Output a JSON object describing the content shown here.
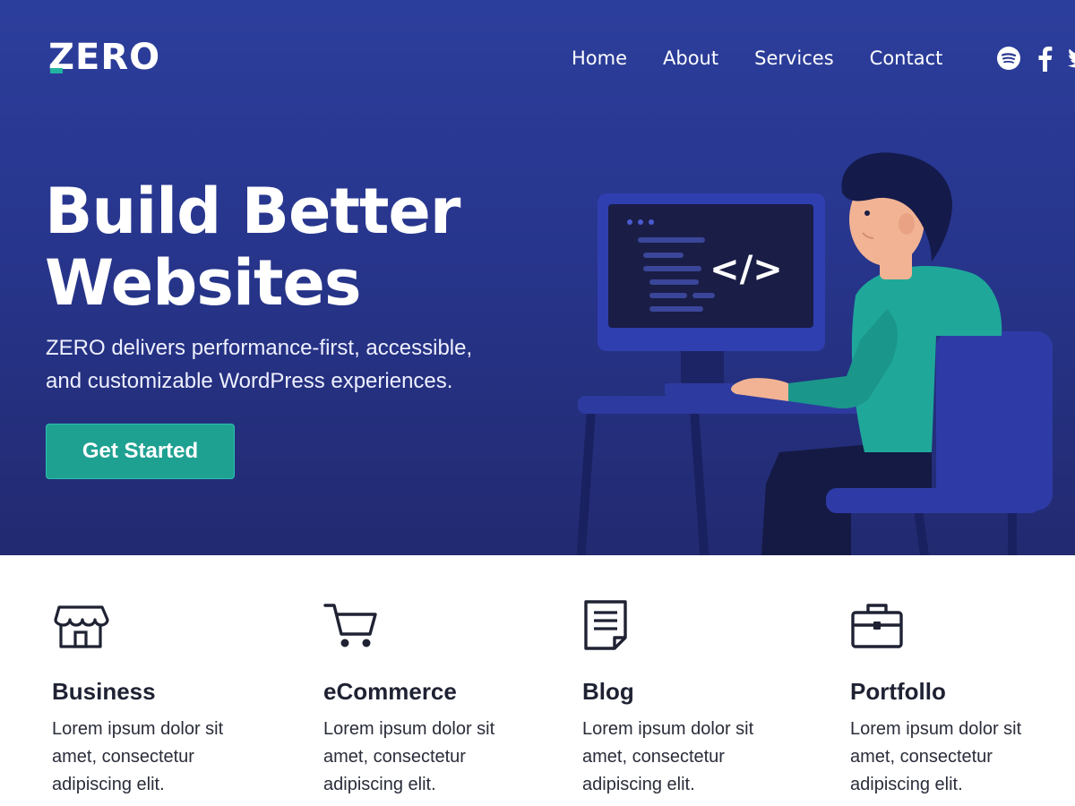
{
  "header": {
    "logo": "ZERO",
    "nav": [
      {
        "label": "Home"
      },
      {
        "label": "About"
      },
      {
        "label": "Services"
      },
      {
        "label": "Contact"
      }
    ],
    "social": [
      "spotify-icon",
      "facebook-icon",
      "twitter-icon"
    ]
  },
  "hero": {
    "headline_line1": "Build Better",
    "headline_line2": "Websites",
    "subline_line1": "ZERO delivers performance-first, accessible,",
    "subline_line2": "and customizable WordPress experiences.",
    "cta_label": "Get Started",
    "code_symbol": "</>"
  },
  "features": [
    {
      "icon": "storefront-icon",
      "title": "Business",
      "desc": "Lorem ipsum dolor sit amet, consectetur adipiscing elit."
    },
    {
      "icon": "shopping-cart-icon",
      "title": "eCommerce",
      "desc": "Lorem ipsum dolor sit amet, consectetur adipiscing elit."
    },
    {
      "icon": "document-icon",
      "title": "Blog",
      "desc": "Lorem ipsum dolor sit amet, consectetur adipiscing elit."
    },
    {
      "icon": "briefcase-icon",
      "title": "Portfollo",
      "desc": "Lorem ipsum dolor sit amet, consectetur adipiscing elit."
    }
  ],
  "colors": {
    "hero_top": "#2c3e9c",
    "hero_bottom": "#222a70",
    "accent": "#1fa192",
    "text_dark": "#1f2233"
  }
}
